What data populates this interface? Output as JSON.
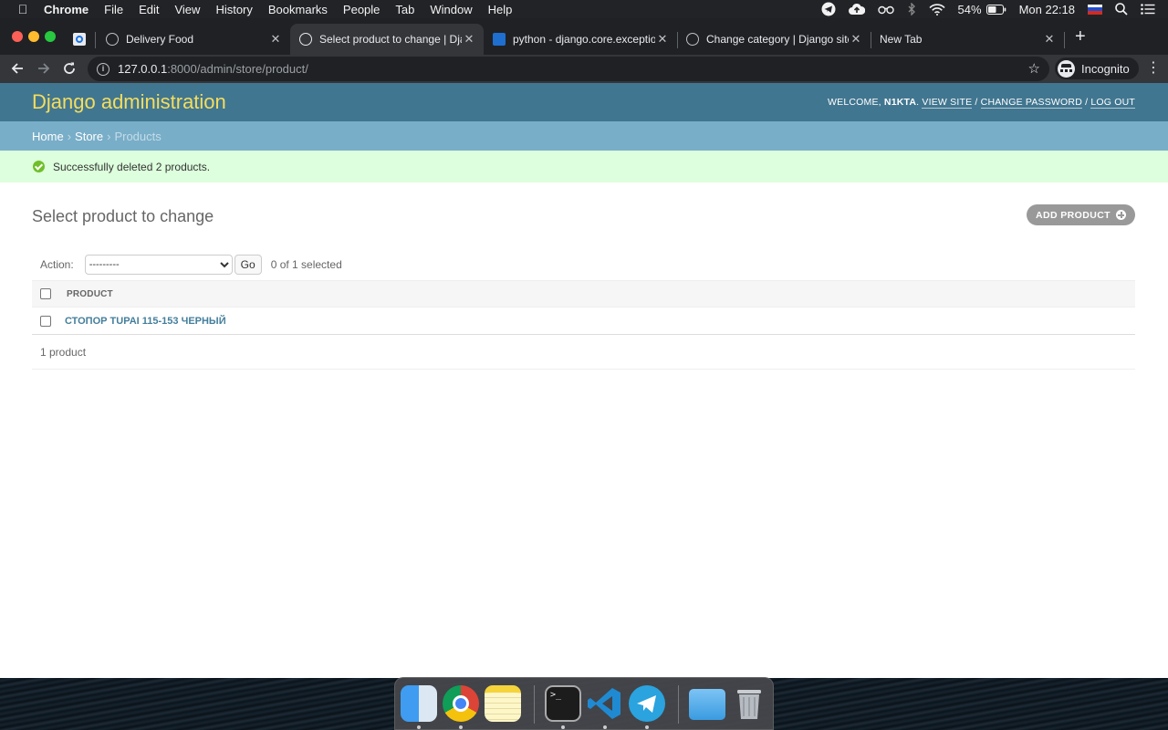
{
  "menubar": {
    "app": "Chrome",
    "items": [
      "File",
      "Edit",
      "View",
      "History",
      "Bookmarks",
      "People",
      "Tab",
      "Window",
      "Help"
    ],
    "battery": "54%",
    "clock": "Mon 22:18"
  },
  "tabs": [
    {
      "title": "Delivery Food"
    },
    {
      "title": "Select product to change | Django"
    },
    {
      "title": "python - django.core.exceptions"
    },
    {
      "title": "Change category | Django site"
    },
    {
      "title": "New Tab"
    }
  ],
  "toolbar": {
    "url_host": "127.0.0.1",
    "url_rest": ":8000/admin/store/product/",
    "profile": "Incognito"
  },
  "header": {
    "branding": "Django administration",
    "welcome": "Welcome,",
    "user": "N1KTA",
    "view_site": "View site",
    "change_password": "Change password",
    "log_out": "Log out"
  },
  "breadcrumbs": {
    "home": "Home",
    "store": "Store",
    "current": "Products"
  },
  "message": "Successfully deleted 2 products.",
  "page": {
    "title": "Select product to change",
    "add_button": "ADD PRODUCT"
  },
  "actions": {
    "label": "Action:",
    "selected_option": "---------",
    "go": "Go",
    "counter": "0 of 1 selected"
  },
  "table": {
    "column": "PRODUCT",
    "rows": [
      {
        "name": "Стопор TUPAI 115-153 черный"
      }
    ],
    "paginator": "1 product"
  },
  "colors": {
    "header_bg": "#417690",
    "branding": "#f5dd5d",
    "breadcrumbs_bg": "#79aec8",
    "success_bg": "#ddffdd",
    "link": "#447e9b"
  }
}
